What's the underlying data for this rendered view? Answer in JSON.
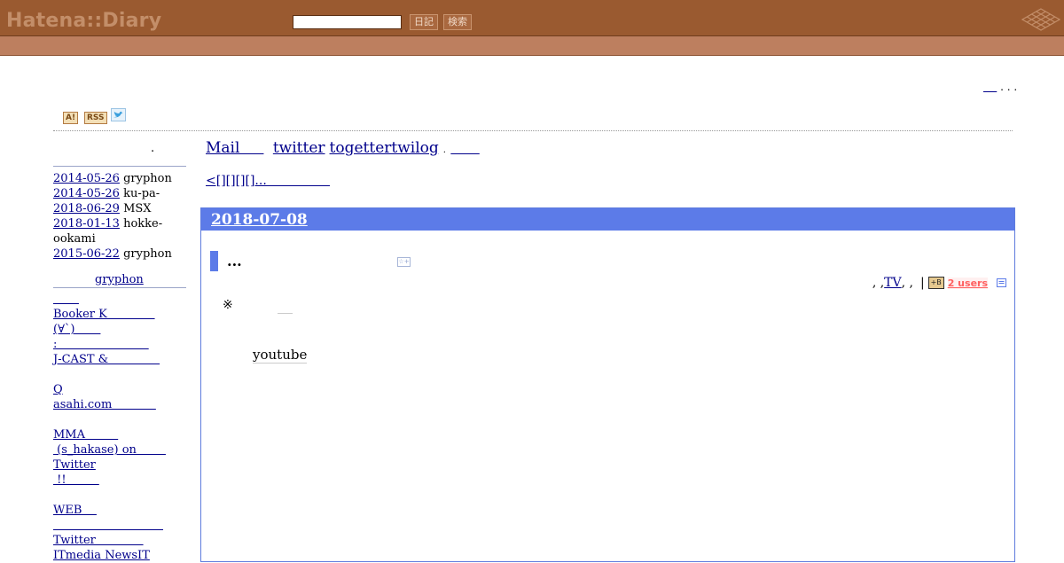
{
  "header": {
    "logo": "Hatena::Diary",
    "search_value": "",
    "diary_button": "日記",
    "search_button": "検索"
  },
  "top_right_link": "    ",
  "top_right_trailing": " . . .",
  "icons": {
    "ai_badge": "A!",
    "rss_badge": "RSS"
  },
  "sidebar": {
    "title_dot": ".",
    "recent": [
      {
        "date": "2014-05-26",
        "text": "gryphon"
      },
      {
        "date": "2014-05-26",
        "text": "ku-pa-"
      },
      {
        "date": "2018-06-29",
        "text": "MSX"
      },
      {
        "date": "2018-01-13",
        "text": "hokke-"
      },
      {
        "date": "",
        "text": "ookami"
      },
      {
        "date": "2015-06-22",
        "text": "gryphon"
      }
    ],
    "author_link": "gryphon",
    "links": [
      "       ",
      "Booker K             ",
      "(∀`)       ",
      ":                         ",
      "J-CAST &              ",
      "",
      "Q",
      "asahi.com            ",
      "",
      "MMA         ",
      " (s_hakase) on        ",
      "Twitter",
      " !!         ",
      "",
      "WEB    ",
      "                              ",
      "Twitter             ",
      "ITmedia NewsIT"
    ]
  },
  "main": {
    "nav": [
      {
        "label": "Mail     "
      },
      {
        "label": "twitter"
      },
      {
        "label": "togettertwilog"
      },
      {
        "label": "      "
      }
    ],
    "nav_dot": ".",
    "pager": "<[][][][]...                ",
    "day": {
      "date": "2018-07-08",
      "section_title": "...",
      "star_label": "☆+",
      "categories_prefix": ", , ",
      "category_tv": "TV",
      "categories_suffix": ", ,",
      "separator": "|",
      "hb_label": "+B",
      "users_badge": "2 users",
      "note_mark": "※",
      "youtube_text": "youtube"
    }
  }
}
